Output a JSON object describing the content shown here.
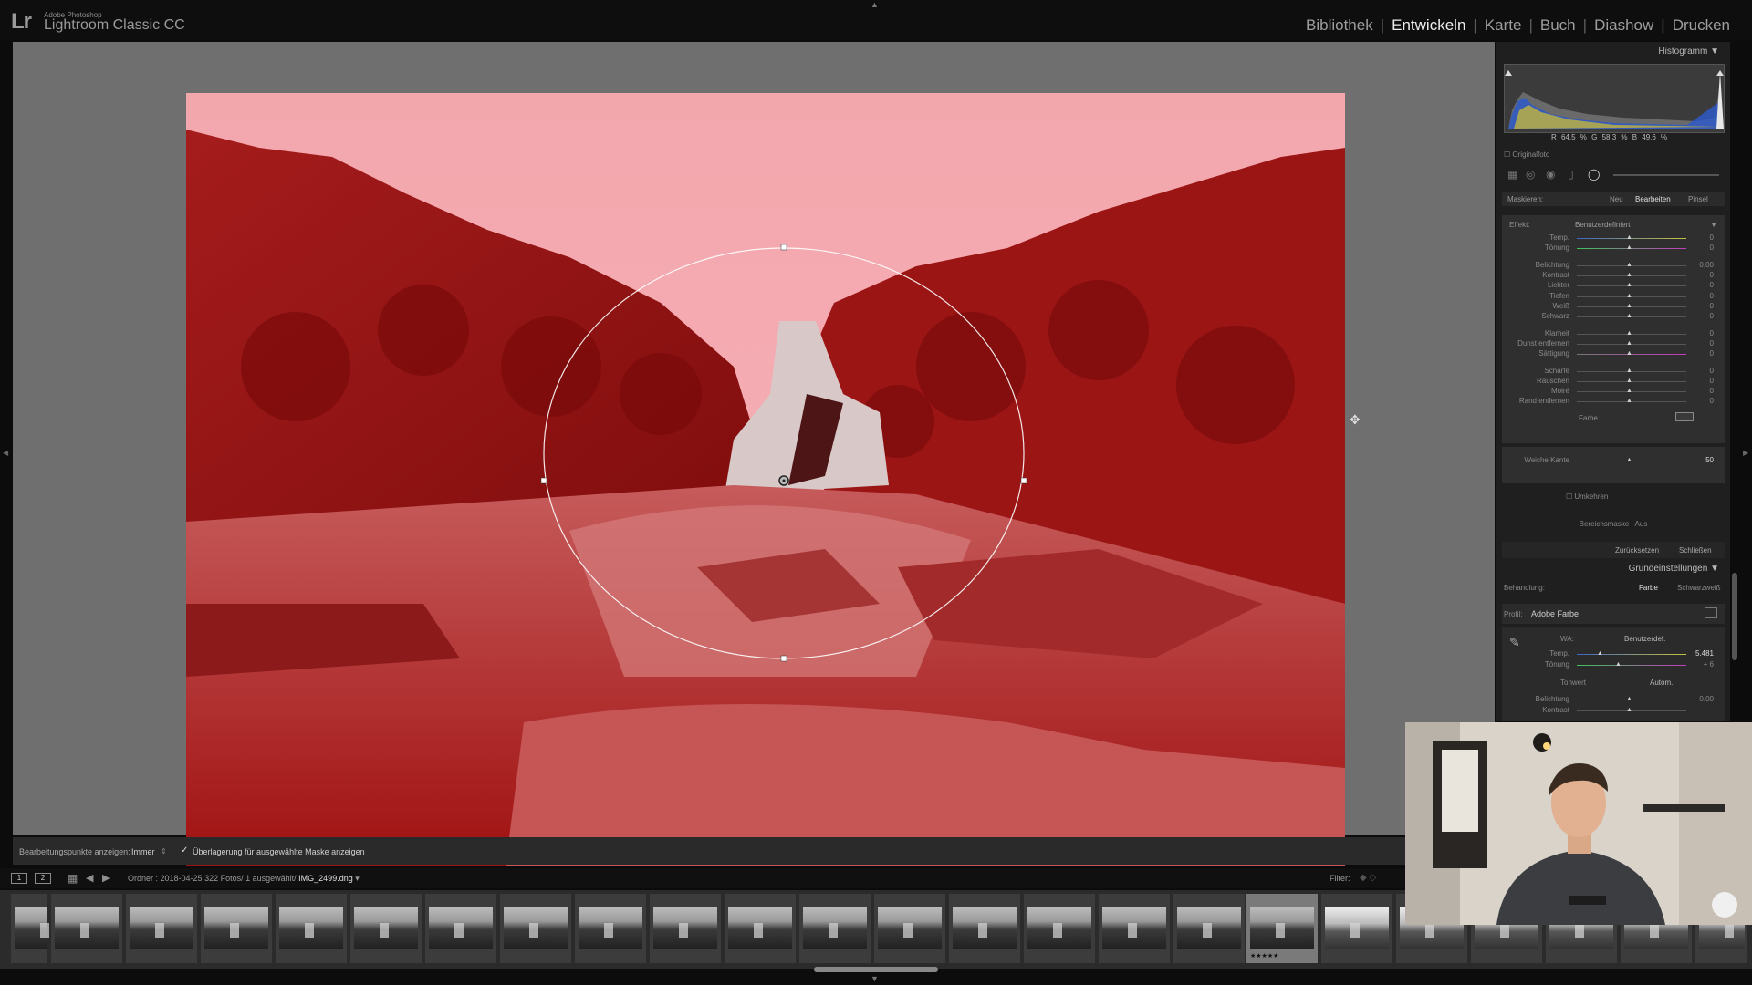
{
  "app": {
    "logo": "Lr",
    "sub": "Adobe Photoshop",
    "name": "Lightroom Classic CC"
  },
  "modules": [
    "Bibliothek",
    "Entwickeln",
    "Karte",
    "Buch",
    "Diashow",
    "Drucken"
  ],
  "active_module": "Entwickeln",
  "toolbar": {
    "edit_pins_label": "Bearbeitungspunkte anzeigen:",
    "edit_pins_value": "Immer",
    "overlay_checked": true,
    "overlay_label": "Überlagerung für ausgewählte Maske anzeigen"
  },
  "filmstrip_header": {
    "screen1": "1",
    "screen2": "2",
    "path": "Ordner : 2018-04-25",
    "count": "322 Fotos/ 1 ausgewählt/",
    "filename": "IMG_2499.dng",
    "filter_label": "Filter:"
  },
  "filmstrip": {
    "selected_index": 16,
    "selected_stars": "★★★★★"
  },
  "right_panel": {
    "histogram_title": "Histogramm",
    "readout": "R 64,5 % G 58,3 % B 49,6 %",
    "original_photo": "Originalfoto",
    "mask_label": "Maskieren:",
    "mask_new": "Neu",
    "mask_edit": "Bearbeiten",
    "mask_brush": "Pinsel",
    "effect_label": "Effekt:",
    "effect_value": "Benutzerdefiniert",
    "sliders": [
      {
        "label": "Temp.",
        "value": "0"
      },
      {
        "label": "Tönung",
        "value": "0"
      },
      {
        "label": "Belichtung",
        "value": "0,00"
      },
      {
        "label": "Kontrast",
        "value": "0"
      },
      {
        "label": "Lichter",
        "value": "0"
      },
      {
        "label": "Tiefen",
        "value": "0"
      },
      {
        "label": "Weiß",
        "value": "0"
      },
      {
        "label": "Schwarz",
        "value": "0"
      },
      {
        "label": "Klarheit",
        "value": "0"
      },
      {
        "label": "Dunst entfernen",
        "value": "0"
      },
      {
        "label": "Sättigung",
        "value": "0"
      },
      {
        "label": "Schärfe",
        "value": "0"
      },
      {
        "label": "Rauschen",
        "value": "0"
      },
      {
        "label": "Moiré",
        "value": "0"
      },
      {
        "label": "Rand entfernen",
        "value": "0"
      }
    ],
    "color_label": "Farbe",
    "feather_label": "Weiche Kante",
    "feather_value": "50",
    "invert_label": "Umkehren",
    "range_mask": "Bereichsmaske : Aus",
    "reset": "Zurücksetzen",
    "close": "Schließen",
    "basic_title": "Grundeinstellungen",
    "treatment_label": "Behandlung:",
    "treatment_color": "Farbe",
    "treatment_bw": "Schwarzweiß",
    "profile_label": "Profil:",
    "profile_value": "Adobe Farbe",
    "wb_label": "WA:",
    "wb_value": "Benutzerdef.",
    "wb_temp_label": "Temp.",
    "wb_temp_value": "5.481",
    "wb_tint_label": "Tönung",
    "wb_tint_value": "+ 6",
    "tone_label": "Tonwert",
    "tone_auto": "Autom.",
    "basic_exposure_label": "Belichtung",
    "basic_exposure_value": "0,00",
    "basic_contrast_label": "Kontrast"
  },
  "colors": {
    "mask_overlay": "#c80000",
    "panel_bg": "#1f1f1f",
    "active_module": "#ededed"
  }
}
